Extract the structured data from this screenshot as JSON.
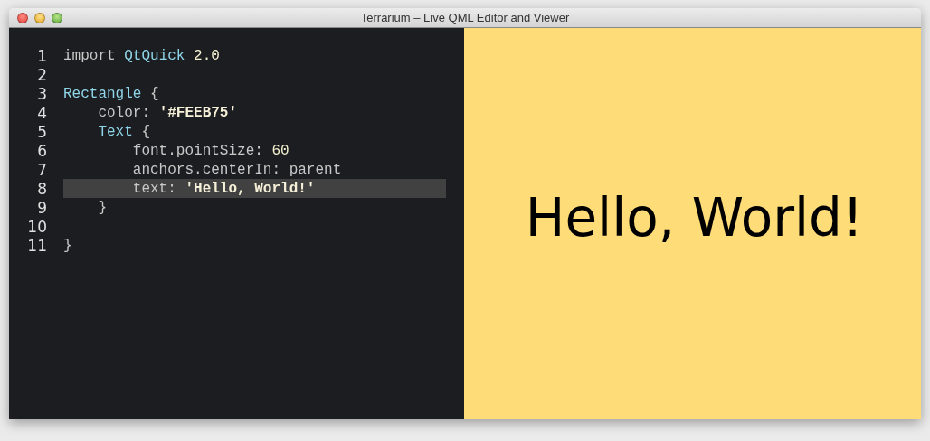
{
  "window": {
    "title": "Terrarium – Live QML Editor and Viewer"
  },
  "editor": {
    "lines": [
      {
        "number": "1",
        "current": false,
        "tokens": [
          {
            "text": "import ",
            "kind": "keyword"
          },
          {
            "text": "QtQuick",
            "kind": "type"
          },
          {
            "text": " 2.0",
            "kind": "number"
          }
        ]
      },
      {
        "number": "2",
        "current": false
      },
      {
        "number": "3",
        "current": false,
        "tokens": [
          {
            "text": "Rectangle",
            "kind": "type"
          },
          {
            "text": " {",
            "kind": "punct"
          }
        ]
      },
      {
        "number": "4",
        "current": false,
        "tokens": [
          {
            "text": "    color: ",
            "kind": "plain"
          },
          {
            "text": "'#FEEB75'",
            "kind": "string"
          }
        ]
      },
      {
        "number": "5",
        "current": false,
        "tokens": [
          {
            "text": "    Text",
            "kind": "type"
          },
          {
            "text": " {",
            "kind": "punct"
          }
        ]
      },
      {
        "number": "6",
        "current": false,
        "tokens": [
          {
            "text": "        font.pointSize: ",
            "kind": "plain"
          },
          {
            "text": "60",
            "kind": "number"
          }
        ]
      },
      {
        "number": "7",
        "current": false,
        "tokens": [
          {
            "text": "        anchors.centerIn: parent",
            "kind": "plain"
          }
        ]
      },
      {
        "number": "8",
        "current": true,
        "tokens": [
          {
            "text": "        text: ",
            "kind": "plain"
          },
          {
            "text": "'Hello, World!'",
            "kind": "string"
          }
        ]
      },
      {
        "number": "9",
        "current": false,
        "tokens": [
          {
            "text": "    }",
            "kind": "punct"
          }
        ]
      },
      {
        "number": "10",
        "current": false
      },
      {
        "number": "11",
        "current": false,
        "tokens": [
          {
            "text": "}",
            "kind": "punct"
          }
        ]
      }
    ]
  },
  "viewer": {
    "text": "Hello, World!"
  }
}
